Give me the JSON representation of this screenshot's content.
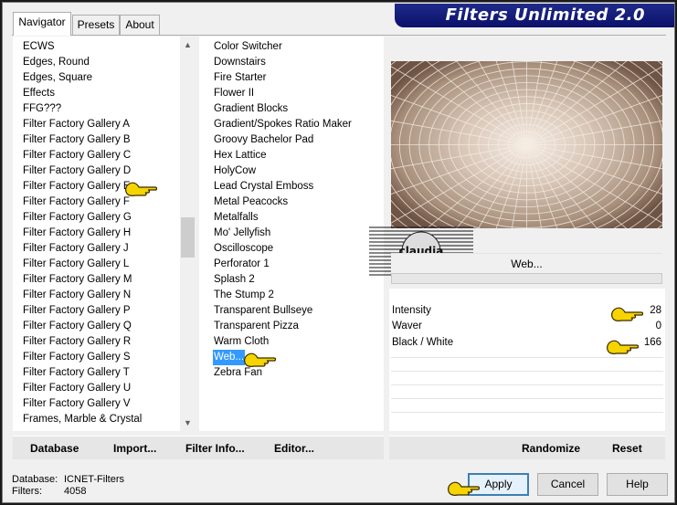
{
  "app": {
    "title": "Filters Unlimited 2.0"
  },
  "tabs": [
    {
      "label": "Navigator",
      "active": true
    },
    {
      "label": "Presets",
      "active": false
    },
    {
      "label": "About",
      "active": false
    }
  ],
  "categories": [
    "ECWS",
    "Edges, Round",
    "Edges, Square",
    "Effects",
    "FFG???",
    "Filter Factory Gallery A",
    "Filter Factory Gallery B",
    "Filter Factory Gallery C",
    "Filter Factory Gallery D",
    "Filter Factory Gallery E",
    "Filter Factory Gallery F",
    "Filter Factory Gallery G",
    "Filter Factory Gallery H",
    "Filter Factory Gallery J",
    "Filter Factory Gallery L",
    "Filter Factory Gallery M",
    "Filter Factory Gallery N",
    "Filter Factory Gallery P",
    "Filter Factory Gallery Q",
    "Filter Factory Gallery R",
    "Filter Factory Gallery S",
    "Filter Factory Gallery T",
    "Filter Factory Gallery U",
    "Filter Factory Gallery V",
    "Frames, Marble & Crystal"
  ],
  "filters": [
    "Color Switcher",
    "Downstairs",
    "Fire Starter",
    "Flower II",
    "Gradient Blocks",
    "Gradient/Spokes Ratio Maker",
    "Groovy Bachelor Pad",
    "Hex Lattice",
    "HolyCow",
    "Lead Crystal Emboss",
    "Metal Peacocks",
    "Metalfalls",
    "Mo' Jellyfish",
    "Oscilloscope",
    "Perforator 1",
    "Splash 2",
    "The Stump 2",
    "Transparent Bullseye",
    "Transparent Pizza",
    "Warm Cloth",
    "Web...",
    "Zebra Fan"
  ],
  "selected_filter": "Web...",
  "preview_button": "Web...",
  "watermark_text": "claudia",
  "params": [
    {
      "label": "Intensity",
      "value": "28"
    },
    {
      "label": "Waver",
      "value": "0"
    },
    {
      "label": "Black / White",
      "value": "166"
    }
  ],
  "toolbar": {
    "database": "Database",
    "import": "Import...",
    "filter_info": "Filter Info...",
    "editor": "Editor...",
    "randomize": "Randomize",
    "reset": "Reset"
  },
  "footer": {
    "database_label": "Database:",
    "database_value": "ICNET-Filters",
    "filters_label": "Filters:",
    "filters_value": "4058"
  },
  "buttons": {
    "apply": "Apply",
    "cancel": "Cancel",
    "help": "Help"
  },
  "colors": {
    "banner": "#0b116a",
    "selection": "#3399ff",
    "pointer_hand": "#f5d400"
  }
}
